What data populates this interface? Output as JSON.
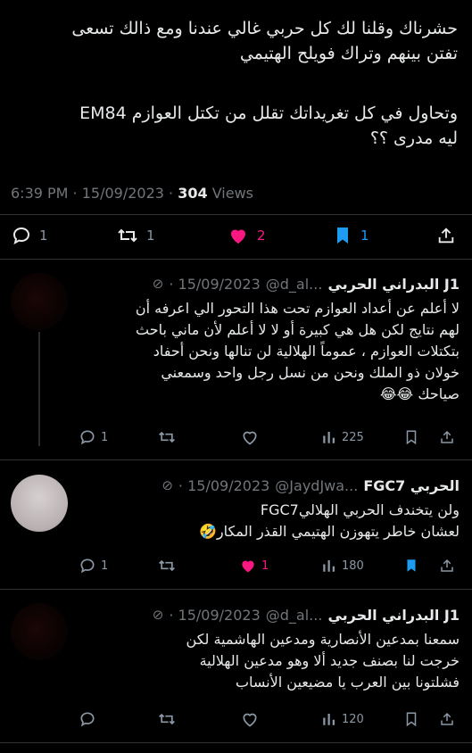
{
  "tweet": {
    "text_line1": "حشرناك وقلنا  لك كل حربي غالي عندنا ومع ذالك تسعى",
    "text_line2": "تفتن بينهم  وتراك فويلح الهتيمي",
    "text_line3": "وتحاول في كل تغريداتك تقلل من تكتل العوازم EM84",
    "text_line4": "ليه مدرى ؟؟",
    "time": "6:39 PM · 15/09/2023 · ",
    "views_count": "304",
    "views_label": " Views",
    "stats": {
      "replies": "1",
      "retweets": "1",
      "likes": "2",
      "bookmarks": "1"
    },
    "colors": {
      "like": "#f91880",
      "bookmark": "#1d9bf0"
    }
  },
  "replies": [
    {
      "name": "البدراني الحربي J1",
      "handle": "@d_al...",
      "date": "· 15/09/2023",
      "lines": [
        "لا أعلم عن أعداد العوازم تحت هذا التحور الي اعرفه أن",
        "لهم نتايج لكن هل هي كبيرة أو لا لا أعلم لأن ماني باحث",
        "بتكتلات العوازم ، عموماً الهلالية لن تنالها  ونحن أحفاد",
        "خولان ذو الملك ونحن من نسل رجل واحد وسمعني",
        "صياحك 😂😂"
      ],
      "stats": {
        "replies": "1",
        "retweets": "",
        "likes": "",
        "views": "225"
      }
    },
    {
      "name": "FGC7 الحربي",
      "handle": "@JaydJwa...",
      "date": "· 15/09/2023",
      "lines": [
        "ولن يتخندف الحربي الهلاليFGC7",
        "لعشان خاطر يتهوزن الهتيمي القذر المكار🤣"
      ],
      "stats": {
        "replies": "1",
        "retweets": "",
        "likes": "1",
        "views": "180"
      }
    },
    {
      "name": "البدراني الحربي J1",
      "handle": "@d_al...",
      "date": "· 15/09/2023",
      "lines": [
        "سمعنا بمدعين الأنصارية ومدعين الهاشمية لكن",
        "خرجت لنا بصنف جديد ألا وهو مدعين الهلالية",
        "فشلتونا بين العرب يا مضيعين الأنساب"
      ],
      "stats": {
        "replies": "",
        "retweets": "",
        "likes": "",
        "views": "120"
      }
    }
  ]
}
